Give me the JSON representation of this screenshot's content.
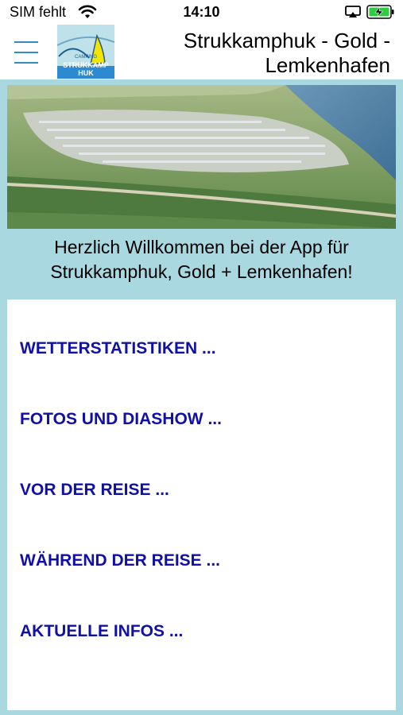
{
  "status_bar": {
    "carrier": "SIM fehlt",
    "time": "14:10",
    "icons": [
      "wifi-icon",
      "airplay-icon",
      "battery-charging-icon"
    ]
  },
  "header": {
    "title": "Strukkamphuk - Gold - Lemkenhafen",
    "logo_text": "STRUKKAMP HUK",
    "logo_small_text": "CAMPING"
  },
  "hero": {
    "icon": "aerial-photo"
  },
  "welcome_text": "Herzlich Willkommen bei der App für Strukkamphuk, Gold + Lemkenhafen!",
  "menu": {
    "items": [
      {
        "label": "WETTERSTATISTIKEN ..."
      },
      {
        "label": "FOTOS UND DIASHOW ..."
      },
      {
        "label": "VOR DER REISE ..."
      },
      {
        "label": "WÄHREND DER REISE ..."
      },
      {
        "label": "AKTUELLE INFOS ..."
      }
    ]
  },
  "colors": {
    "background": "#aad8e0",
    "menu_text": "#1010a8",
    "hamburger": "#2f8ebc",
    "battery": "#2ecc40"
  }
}
